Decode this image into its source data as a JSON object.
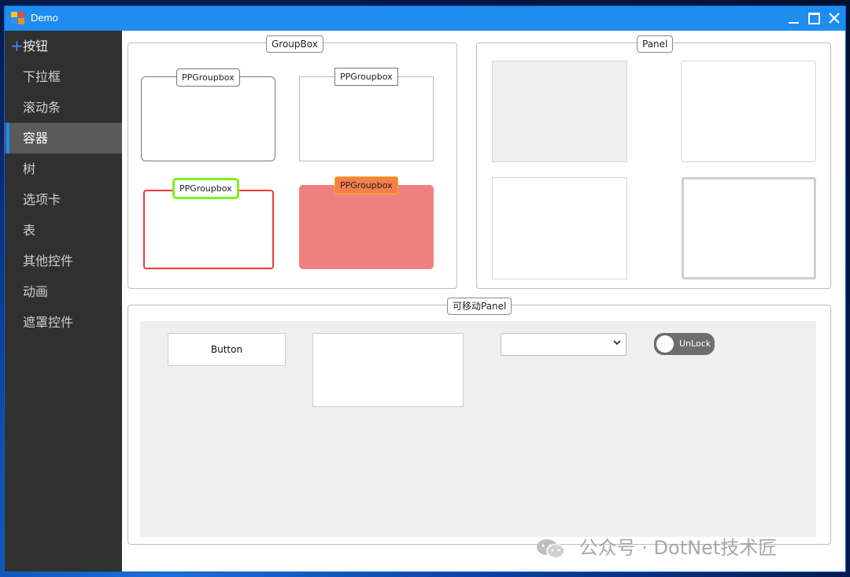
{
  "window": {
    "title": "Demo"
  },
  "sidebar": {
    "header": {
      "icon": "plus-icon",
      "label": "按钮"
    },
    "items": [
      {
        "label": "下拉框"
      },
      {
        "label": "滚动条"
      },
      {
        "label": "容器",
        "active": true
      },
      {
        "label": "树"
      },
      {
        "label": "选项卡"
      },
      {
        "label": "表"
      },
      {
        "label": "其他控件"
      },
      {
        "label": "动画"
      },
      {
        "label": "遮罩控件"
      }
    ]
  },
  "groupbox_section": {
    "legend": "GroupBox",
    "boxes": [
      {
        "label": "PPGroupbox",
        "style": "rounded-gray"
      },
      {
        "label": "PPGroupbox",
        "style": "square-gray"
      },
      {
        "label": "PPGroupbox",
        "style": "red-border-green-label",
        "border_color": "#f23838",
        "label_border_color": "#7cf21b"
      },
      {
        "label": "PPGroupbox",
        "style": "filled",
        "fill_color": "#f08080",
        "label_fill_color": "#f5804a"
      }
    ]
  },
  "panel_section": {
    "legend": "Panel",
    "panels": [
      {
        "style": "gray-fill",
        "fill_color": "#efefef"
      },
      {
        "style": "white-rounded"
      },
      {
        "style": "white-square"
      },
      {
        "style": "thick-border",
        "border_color": "#cfcfcf"
      }
    ]
  },
  "movable_section": {
    "legend": "可移动Panel",
    "button_label": "Button",
    "combo_value": "",
    "toggle_label": "UnLock"
  },
  "watermark": {
    "text": "公众号 · DotNet技术匠",
    "icon": "wechat-icon"
  },
  "colors": {
    "titlebar": "#1e8cf0",
    "sidebar": "#303030",
    "sidebar_active": "#5a5a5a",
    "accent": "#1e8cf0"
  }
}
